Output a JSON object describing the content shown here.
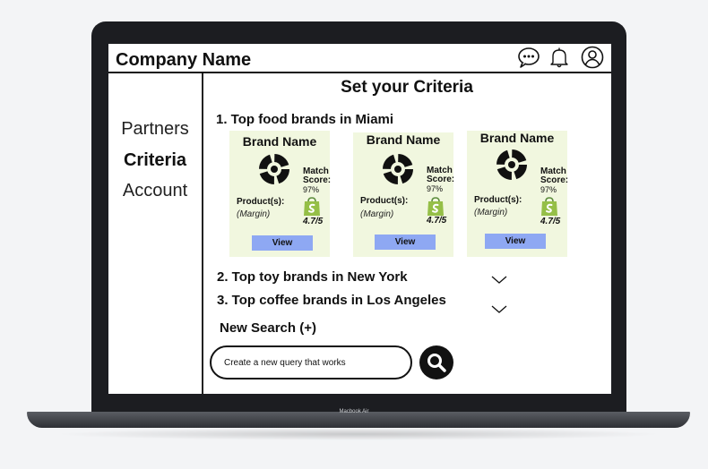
{
  "device": {
    "model_label": "Macbook Air"
  },
  "header": {
    "company_name": "Company Name",
    "icons": [
      "chat-icon",
      "bell-icon",
      "user-icon"
    ],
    "icon_captions": [
      "",
      "",
      ""
    ]
  },
  "sidebar": {
    "items": [
      {
        "label": "Partners",
        "active": false
      },
      {
        "label": "Criteria",
        "active": true
      },
      {
        "label": "Account",
        "active": false
      }
    ]
  },
  "main": {
    "title": "Set your Criteria",
    "criteria": [
      {
        "label": "1. Top food brands in Miami",
        "expanded": true
      },
      {
        "label": "2. Top toy brands in New York",
        "expanded": false
      },
      {
        "label": "3. Top coffee brands in Los Angeles",
        "expanded": false
      }
    ],
    "brands": [
      {
        "name": "Brand Name",
        "match_label": "Match Score:",
        "match_value": "97%",
        "product_label": "Product(s):",
        "margin": "(Margin)",
        "rating": "4.7/5",
        "view_label": "View"
      },
      {
        "name": "Brand Name",
        "match_label": "Match Score:",
        "match_value": "97%",
        "product_label": "Product(s):",
        "margin": "(Margin)",
        "rating": "4.7/5",
        "view_label": "View"
      },
      {
        "name": "Brand Name",
        "match_label": "Match Score:",
        "match_value": "97%",
        "product_label": "Product(s):",
        "margin": "(Margin)",
        "rating": "4.7/5",
        "view_label": "View"
      }
    ],
    "new_search_label": "New Search (+)",
    "search": {
      "value": "Create a new query that works",
      "placeholder": ""
    }
  },
  "colors": {
    "card_background": "#f1f7df",
    "view_button": "#8ea8f3",
    "shopify_green": "#95bf47",
    "text": "#111111"
  }
}
